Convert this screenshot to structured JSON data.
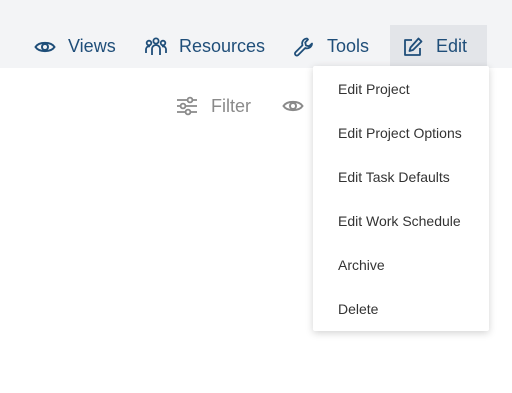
{
  "toolbar": {
    "items": [
      {
        "label": "Views",
        "icon": "eye-icon"
      },
      {
        "label": "Resources",
        "icon": "people-group-icon"
      },
      {
        "label": "Tools",
        "icon": "wrench-icon"
      },
      {
        "label": "Edit",
        "icon": "edit-pencil-square-icon",
        "active": true
      }
    ]
  },
  "subbar": {
    "filter_label": "Filter",
    "filter_icon": "sliders-icon",
    "view_icon": "eye-icon"
  },
  "edit_menu": {
    "items": [
      {
        "label": "Edit Project"
      },
      {
        "label": "Edit Project Options"
      },
      {
        "label": "Edit Task Defaults"
      },
      {
        "label": "Edit Work Schedule"
      },
      {
        "label": "Archive"
      },
      {
        "label": "Delete"
      }
    ]
  },
  "colors": {
    "nav_text": "#1f4e79",
    "topbar_bg": "#f3f4f6",
    "active_bg": "#e3e5e9",
    "muted_text": "#8a8a8a"
  }
}
